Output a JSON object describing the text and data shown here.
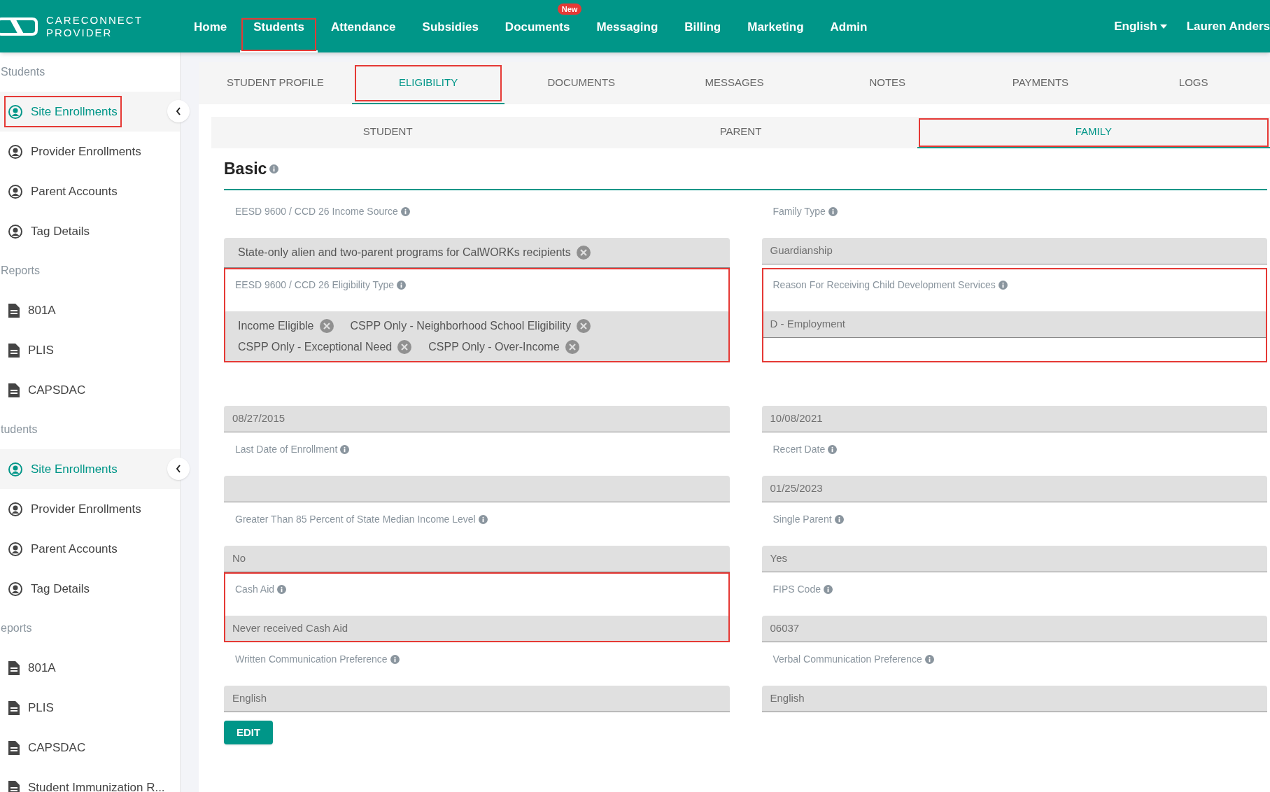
{
  "logo": {
    "line_1": "CARECONNECT",
    "line_2": "PROVIDER"
  },
  "nav": [
    {
      "label": "Home",
      "selected": false,
      "highlighted": false
    },
    {
      "label": "Students",
      "selected": true,
      "highlighted": true
    },
    {
      "label": "Attendance",
      "selected": false,
      "highlighted": false
    },
    {
      "label": "Subsidies",
      "selected": false,
      "highlighted": false
    },
    {
      "label": "Documents",
      "selected": false,
      "highlighted": false,
      "badge": "New"
    },
    {
      "label": "Messaging",
      "selected": false,
      "highlighted": false
    },
    {
      "label": "Billing",
      "selected": false,
      "highlighted": false
    },
    {
      "label": "Marketing",
      "selected": false,
      "highlighted": false
    },
    {
      "label": "Admin",
      "selected": false,
      "highlighted": false
    }
  ],
  "language": "English",
  "user": "Lauren Anders",
  "sidebar_sections": [
    {
      "items": [
        {
          "kind": "heading",
          "label": "Students"
        },
        {
          "kind": "person",
          "label": "Site Enrollments",
          "selected": true,
          "highlighted": true
        },
        {
          "kind": "person",
          "label": "Provider Enrollments",
          "selected": false,
          "highlighted": false
        },
        {
          "kind": "person",
          "label": "Parent Accounts",
          "selected": false,
          "highlighted": false
        },
        {
          "kind": "person",
          "label": "Tag Details",
          "selected": false,
          "highlighted": false
        },
        {
          "kind": "heading",
          "label": "Reports"
        },
        {
          "kind": "report",
          "label": "801A",
          "selected": false,
          "highlighted": false
        },
        {
          "kind": "report",
          "label": "PLIS",
          "selected": false,
          "highlighted": false
        },
        {
          "kind": "report",
          "label": "CAPSDAC",
          "selected": false,
          "highlighted": false
        }
      ]
    },
    {
      "items": [
        {
          "kind": "heading",
          "label": "tudents"
        },
        {
          "kind": "person",
          "label": "Site Enrollments",
          "selected": true,
          "highlighted": false
        },
        {
          "kind": "person",
          "label": "Provider Enrollments",
          "selected": false,
          "highlighted": false
        },
        {
          "kind": "person",
          "label": "Parent Accounts",
          "selected": false,
          "highlighted": false
        },
        {
          "kind": "person",
          "label": "Tag Details",
          "selected": false,
          "highlighted": false
        },
        {
          "kind": "heading",
          "label": "eports"
        },
        {
          "kind": "report",
          "label": "801A",
          "selected": false,
          "highlighted": false
        },
        {
          "kind": "report",
          "label": "PLIS",
          "selected": false,
          "highlighted": false
        },
        {
          "kind": "report",
          "label": "CAPSDAC",
          "selected": false,
          "highlighted": false
        },
        {
          "kind": "report",
          "label": "Student Immunization R...",
          "selected": false,
          "highlighted": false
        }
      ]
    }
  ],
  "tabs": [
    {
      "label": "STUDENT PROFILE",
      "selected": false,
      "highlighted": false
    },
    {
      "label": "ELIGIBILITY",
      "selected": true,
      "highlighted": true
    },
    {
      "label": "DOCUMENTS",
      "selected": false,
      "highlighted": false
    },
    {
      "label": "MESSAGES",
      "selected": false,
      "highlighted": false
    },
    {
      "label": "NOTES",
      "selected": false,
      "highlighted": false
    },
    {
      "label": "PAYMENTS",
      "selected": false,
      "highlighted": false
    },
    {
      "label": "LOGS",
      "selected": false,
      "highlighted": false
    }
  ],
  "subtabs": [
    {
      "label": "STUDENT",
      "selected": false,
      "highlighted": false
    },
    {
      "label": "PARENT",
      "selected": false,
      "highlighted": false
    },
    {
      "label": "FAMILY",
      "selected": true,
      "highlighted": true
    }
  ],
  "section_title": "Basic",
  "fields": [
    {
      "kind": "chips",
      "label": "EESD 9600 / CCD 26 Income Source",
      "values": [
        "State-only alien and two-parent programs for CalWORKs recipients"
      ],
      "highlighted": false
    },
    {
      "kind": "text",
      "label": "Family Type",
      "value": "Guardianship",
      "highlighted": false
    },
    {
      "kind": "chips",
      "label": "EESD 9600 / CCD 26 Eligibility Type",
      "values": [
        "Income Eligible",
        "CSPP Only - Neighborhood School Eligibility",
        "CSPP Only - Exceptional Need",
        "CSPP Only - Over-Income"
      ],
      "highlighted": true
    },
    {
      "kind": "text",
      "label": "Reason For Receiving Child Development Services",
      "value": "D - Employment",
      "highlighted": true
    },
    {
      "kind": "text",
      "value": "08/27/2015",
      "highlighted": false
    },
    {
      "kind": "text",
      "value": "10/08/2021",
      "highlighted": false
    },
    {
      "kind": "text",
      "label": "Last Date of Enrollment",
      "highlighted": false
    },
    {
      "kind": "text",
      "label": "Recert Date",
      "value": "01/25/2023",
      "highlighted": false
    },
    {
      "kind": "text",
      "label": "Greater Than 85 Percent of State Median Income Level",
      "value": "No",
      "highlighted": false
    },
    {
      "kind": "text",
      "label": "Single Parent",
      "value": "Yes",
      "highlighted": false
    },
    {
      "kind": "text",
      "label": "Cash Aid",
      "value": "Never received Cash Aid",
      "highlighted": true
    },
    {
      "kind": "text",
      "label": "FIPS Code",
      "value": "06037",
      "highlighted": false
    },
    {
      "kind": "text",
      "label": "Written Communication Preference",
      "value": "English",
      "highlighted": false
    },
    {
      "kind": "text",
      "label": "Verbal Communication Preference",
      "value": "English",
      "highlighted": false
    }
  ],
  "edit_button": "EDIT"
}
